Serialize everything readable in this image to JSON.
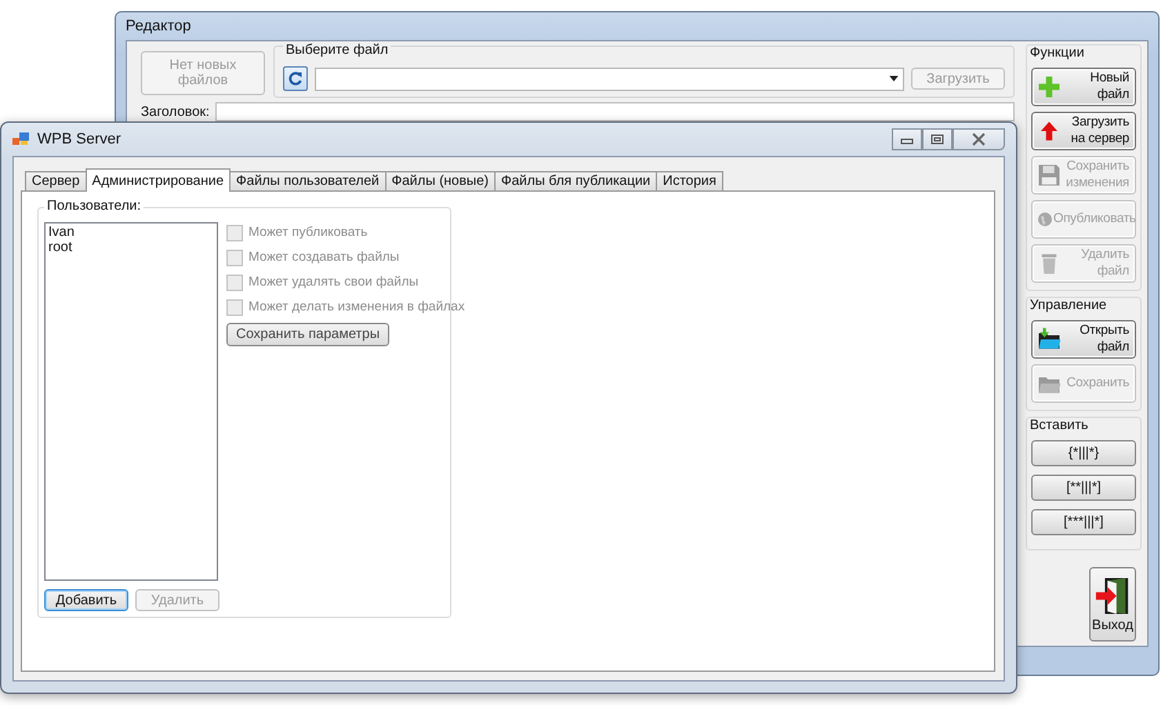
{
  "editor_window": {
    "title": "Редактор",
    "no_new_files_button": {
      "label": "Нет новых файлов",
      "disabled": true
    },
    "file_group": {
      "title": "Выберите файл",
      "upload_button": {
        "label": "Загрузить",
        "disabled": true
      }
    },
    "heading_label": "Заголовок:",
    "functions": {
      "title": "Функции",
      "buttons": [
        {
          "kind": "new",
          "label": "Новый файл",
          "disabled": false
        },
        {
          "kind": "upload",
          "label": "Загрузить на сервер",
          "disabled": false
        },
        {
          "kind": "save",
          "label": "Сохранить изменения",
          "disabled": true
        },
        {
          "kind": "publish",
          "label": "Опубликовать",
          "disabled": true
        },
        {
          "kind": "delete",
          "label": "Удалить файл",
          "disabled": true
        }
      ]
    },
    "management": {
      "title": "Управление",
      "buttons": [
        {
          "kind": "open",
          "label": "Открыть файл",
          "disabled": false
        },
        {
          "kind": "folder",
          "label": "Сохранить",
          "disabled": true
        }
      ]
    },
    "insert": {
      "title": "Вставить",
      "buttons": [
        "{*|||*}",
        "[**|||*]",
        "[***|||*]"
      ]
    },
    "exit_button": "Выход"
  },
  "server_window": {
    "title": "WPB Server",
    "tabs": [
      {
        "label": "Сервер",
        "selected": false
      },
      {
        "label": "Администрирование",
        "selected": true
      },
      {
        "label": "Файлы пользователей",
        "selected": false
      },
      {
        "label": "Файлы (новые)",
        "selected": false
      },
      {
        "label": "Файлы бля публикации",
        "selected": false
      },
      {
        "label": "История",
        "selected": false
      }
    ],
    "users_group": {
      "title": "Пользователи:",
      "users": [
        "Ivan",
        "root"
      ],
      "permissions": [
        {
          "label": "Может публиковать",
          "checked": false,
          "disabled": true
        },
        {
          "label": "Может создавать файлы",
          "checked": false,
          "disabled": true
        },
        {
          "label": "Может удалять свои файлы",
          "checked": false,
          "disabled": true
        },
        {
          "label": "Может делать изменения в файлах",
          "checked": false,
          "disabled": true
        }
      ],
      "save_button": {
        "label": "Сохранить параметры",
        "disabled": false
      },
      "add_button": {
        "label": "Добавить",
        "focused": true
      },
      "delete_button": {
        "label": "Удалить",
        "disabled": true
      }
    }
  }
}
